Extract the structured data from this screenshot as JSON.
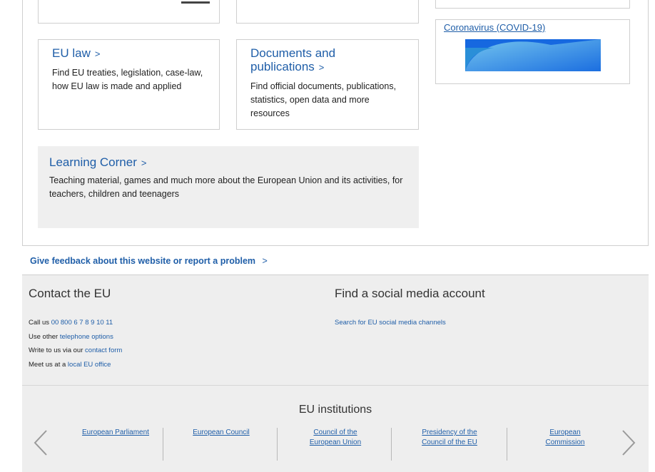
{
  "cards": {
    "eu_law": {
      "title": "EU law",
      "chevron": ">",
      "description": "Find EU treaties, legislation, case-law, how EU law is made and applied"
    },
    "documents": {
      "title_line1": "Documents and",
      "title_line2": "publications",
      "chevron": ">",
      "description": "Find official documents, publications, statistics, open data and more resources"
    },
    "learning": {
      "title": "Learning Corner",
      "chevron": ">",
      "description": "Teaching material, games and much more about the European Union and its activities, for teachers, children and teenagers"
    }
  },
  "covid": {
    "title": "Coronavirus (COVID-19)"
  },
  "feedback": {
    "label": "Give feedback about this website or report a problem",
    "chevron": ">"
  },
  "contact": {
    "heading": "Contact the EU",
    "call_prefix": "Call us ",
    "call_number": "00 800 6 7 8 9 10 11",
    "other_prefix": "Use other ",
    "other_link": "telephone options",
    "write_prefix": "Write to us via our ",
    "write_link": "contact form",
    "meet_prefix": "Meet us at a ",
    "meet_link": "local EU office"
  },
  "social": {
    "heading": "Find a social media account",
    "link": "Search for EU social media channels"
  },
  "institutions": {
    "heading": "EU institutions",
    "items": [
      {
        "label": "European Parliament"
      },
      {
        "label": "European Council"
      },
      {
        "label": "Council of the European Union"
      },
      {
        "label": "Presidency of the Council of the EU"
      },
      {
        "label": "European Commission"
      }
    ]
  },
  "colors": {
    "link": "#1f5ea8",
    "band": "#eeeeee",
    "learning_bg": "#efefef"
  }
}
